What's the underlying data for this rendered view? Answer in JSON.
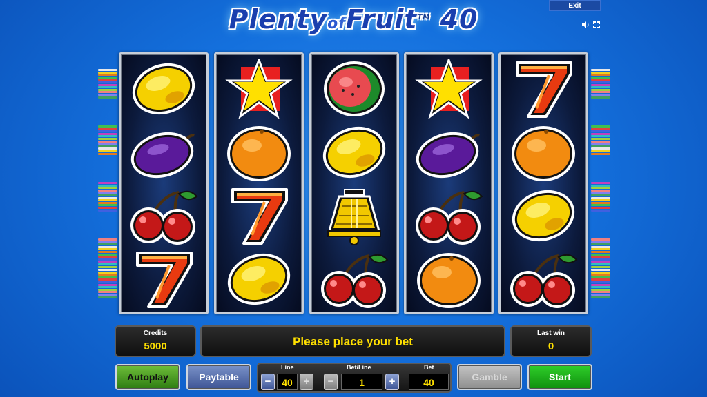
{
  "header": {
    "title_main": "Plenty",
    "title_of": "of",
    "title_fruit": "Fruit",
    "title_tm": "TM",
    "title_num": "40",
    "exit_label": "Exit"
  },
  "icons": {
    "sound": "speaker-icon",
    "fullscreen": "fullscreen-icon"
  },
  "reels": [
    [
      "lemon",
      "plum",
      "cherries",
      "seven"
    ],
    [
      "star",
      "orange",
      "seven",
      "lemon"
    ],
    [
      "watermelon",
      "lemon",
      "bell",
      "cherries"
    ],
    [
      "star",
      "plum",
      "cherries",
      "orange"
    ],
    [
      "seven",
      "orange",
      "lemon",
      "cherries"
    ]
  ],
  "info": {
    "credits_label": "Credits",
    "credits_value": "5000",
    "message": "Please place your bet",
    "lastwin_label": "Last win",
    "lastwin_value": "0"
  },
  "controls": {
    "autoplay": "Autoplay",
    "paytable": "Paytable",
    "line_label": "Line",
    "line_value": "40",
    "betline_label": "Bet/Line",
    "betline_value": "1",
    "bet_label": "Bet",
    "bet_value": "40",
    "minus": "−",
    "plus": "+",
    "gamble": "Gamble",
    "start": "Start"
  },
  "colors": {
    "accent_yellow": "#ffe000",
    "start_green": "#1e9a16",
    "background_blue": "#1470dd"
  }
}
